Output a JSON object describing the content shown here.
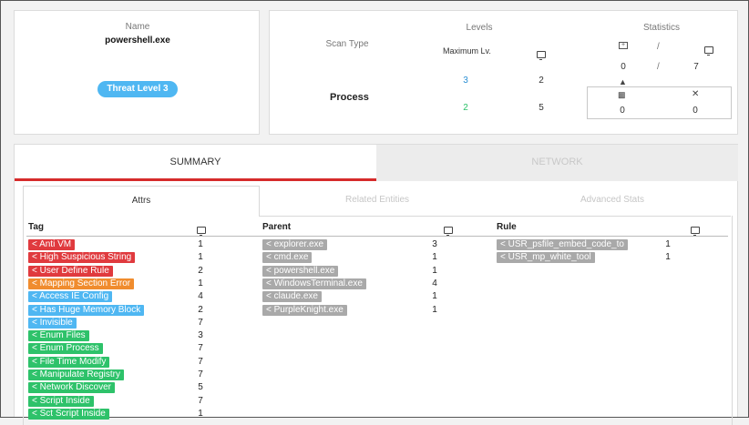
{
  "file": {
    "name_label": "Name",
    "name": "powershell.exe",
    "threat_level": "Threat Level 3"
  },
  "levels": {
    "heading": "Levels",
    "scan_type_label": "Scan Type",
    "maximum_label": "Maximum Lv.",
    "row_label": "Process",
    "max_values": [
      "3",
      "2"
    ],
    "monitor_values": [
      "2",
      "5"
    ]
  },
  "statistics": {
    "heading": "Statistics",
    "slash": "/",
    "top_left": "0",
    "top_right": "7",
    "bottom_left": "0",
    "bottom_right": "0"
  },
  "tabs": {
    "summary": "SUMMARY",
    "network": "NETWORK"
  },
  "subtabs": {
    "attrs": "Attrs",
    "related": "Related Entities",
    "advanced": "Advanced Stats"
  },
  "columns": {
    "tag": "Tag",
    "parent": "Parent",
    "rule": "Rule"
  },
  "colors": {
    "red": "#e03a3e",
    "orange": "#f08c2e",
    "blue": "#4fb7f2",
    "green": "#2ec26a",
    "gray": "#a9a9a9",
    "tab_active": "#d62b2b"
  },
  "tags": [
    {
      "label": "< Anti VM",
      "count": "1",
      "color": "red"
    },
    {
      "label": "< High Suspicious String",
      "count": "1",
      "color": "red"
    },
    {
      "label": "< User Define Rule",
      "count": "2",
      "color": "red"
    },
    {
      "label": "< Mapping Section Error",
      "count": "1",
      "color": "orange"
    },
    {
      "label": "< Access IE Config",
      "count": "4",
      "color": "blue"
    },
    {
      "label": "< Has Huge Memory Block",
      "count": "2",
      "color": "blue"
    },
    {
      "label": "< Invisible",
      "count": "7",
      "color": "blue"
    },
    {
      "label": "< Enum Files",
      "count": "3",
      "color": "green"
    },
    {
      "label": "< Enum Process",
      "count": "7",
      "color": "green"
    },
    {
      "label": "< File Time Modify",
      "count": "7",
      "color": "green"
    },
    {
      "label": "< Manipulate Registry",
      "count": "7",
      "color": "green"
    },
    {
      "label": "< Network Discover",
      "count": "5",
      "color": "green"
    },
    {
      "label": "< Script Inside",
      "count": "7",
      "color": "green"
    },
    {
      "label": "< Sct Script Inside",
      "count": "1",
      "color": "green"
    }
  ],
  "parents": [
    {
      "label": "< explorer.exe",
      "count": "3"
    },
    {
      "label": "< cmd.exe",
      "count": "1"
    },
    {
      "label": "< powershell.exe",
      "count": "1"
    },
    {
      "label": "< WindowsTerminal.exe",
      "count": "4"
    },
    {
      "label": "< claude.exe",
      "count": "1"
    },
    {
      "label": "< PurpleKnight.exe",
      "count": "1"
    }
  ],
  "rules": [
    {
      "label": "< USR_psfile_embed_code_to",
      "count": "1"
    },
    {
      "label": "< USR_mp_white_tool",
      "count": "1"
    }
  ]
}
